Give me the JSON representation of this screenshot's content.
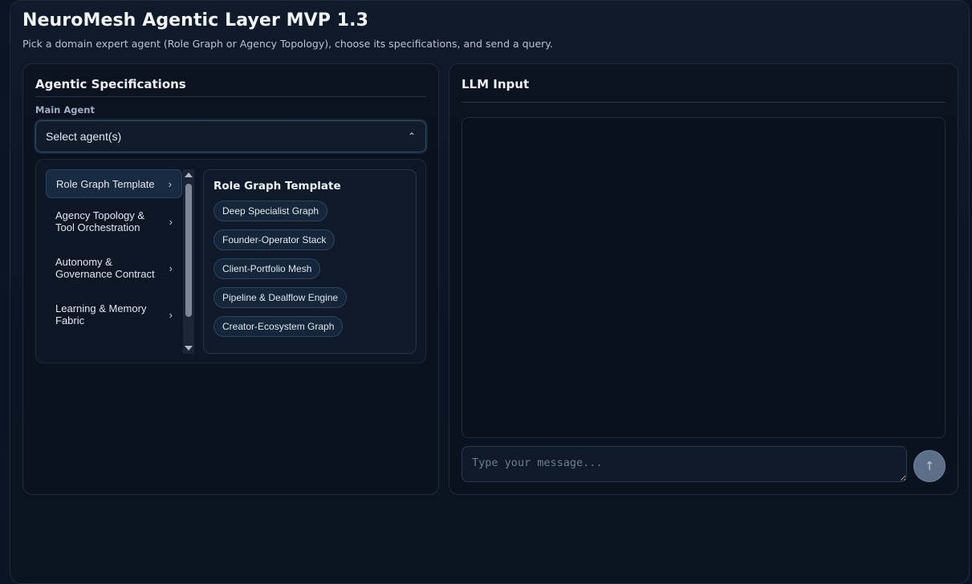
{
  "header": {
    "title": "NeuroMesh Agentic Layer MVP 1.3",
    "subtitle": "Pick a domain expert agent (Role Graph or Agency Topology), choose its specifications, and send a query."
  },
  "left_panel": {
    "title": "Agentic Specifications",
    "main_agent_label": "Main Agent",
    "select_placeholder": "Select agent(s)",
    "categories": [
      {
        "line1": "Role Graph Template",
        "line2": ""
      },
      {
        "line1": "Agency Topology &",
        "line2": "Tool Orchestration"
      },
      {
        "line1": "Autonomy &",
        "line2": "Governance Contract"
      },
      {
        "line1": "Learning & Memory",
        "line2": "Fabric"
      }
    ],
    "active_category_title": "Role Graph Template",
    "options": [
      "Deep Specialist Graph",
      "Founder-Operator Stack",
      "Client-Portfolio Mesh",
      "Pipeline & Dealflow Engine",
      "Creator-Ecosystem Graph"
    ]
  },
  "right_panel": {
    "title": "LLM Input",
    "message_placeholder": "Type your message...",
    "send_icon": "arrow-up-icon"
  },
  "colors": {
    "background": "#0b1422",
    "panel": "#0a121e",
    "chip": "#15263a",
    "send_button": "#5c6f88"
  }
}
